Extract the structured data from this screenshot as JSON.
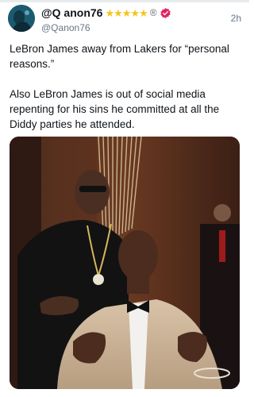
{
  "post": {
    "display_name": "@Q anon76",
    "badge_icons": [
      "star-icon",
      "star-icon",
      "star-icon",
      "star-icon",
      "star-icon",
      "registered-icon",
      "verified-icon"
    ],
    "star_glyph": "★",
    "registered_glyph": "®",
    "handle": "@Qanon76",
    "timestamp": "2h",
    "text_paragraphs": [
      "LeBron James away from Lakers for “personal reasons.”",
      "Also LeBron James is out of social media repenting for his sins he committed at all the Diddy parties he attended."
    ],
    "colors": {
      "star": "#f5c518",
      "verified": "#e0245e",
      "secondary_text": "#687684"
    },
    "media": {
      "type": "photo"
    }
  }
}
